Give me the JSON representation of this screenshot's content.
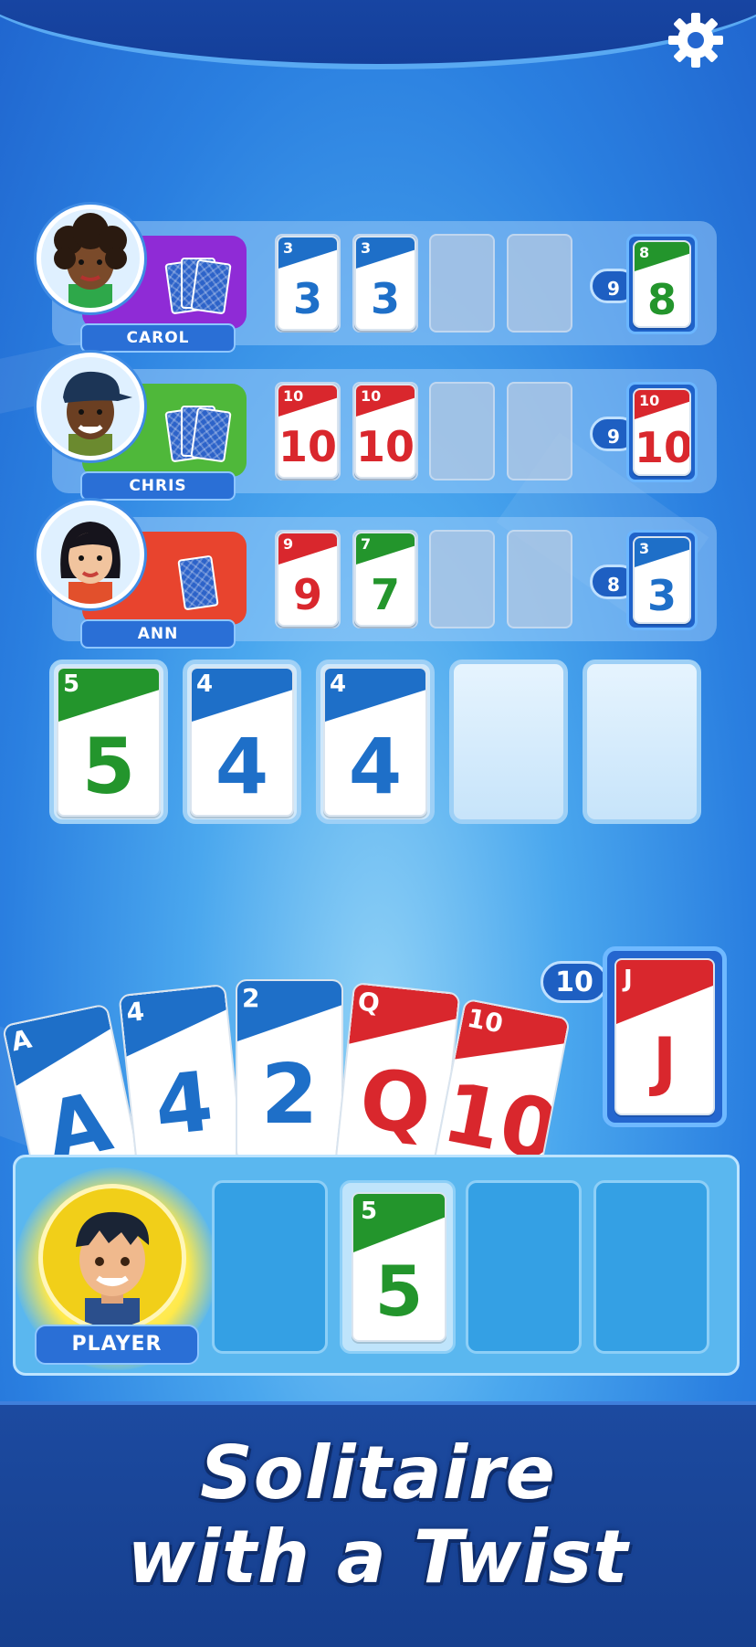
{
  "opponents": [
    {
      "name": "CAROL",
      "tag_color": "#8f2bd6",
      "cards": [
        {
          "v": "3",
          "c": "blue"
        },
        {
          "v": "3",
          "c": "blue"
        }
      ],
      "deck_count": "9",
      "deck_top": {
        "v": "8",
        "c": "green"
      }
    },
    {
      "name": "CHRIS",
      "tag_color": "#4fb83a",
      "cards": [
        {
          "v": "10",
          "c": "red"
        },
        {
          "v": "10",
          "c": "red"
        }
      ],
      "deck_count": "9",
      "deck_top": {
        "v": "10",
        "c": "red"
      }
    },
    {
      "name": "ANN",
      "tag_color": "#e8442e",
      "cards": [
        {
          "v": "9",
          "c": "red"
        },
        {
          "v": "7",
          "c": "green"
        }
      ],
      "deck_count": "8",
      "deck_top": {
        "v": "3",
        "c": "blue"
      }
    }
  ],
  "center_piles": [
    {
      "v": "5",
      "c": "green"
    },
    {
      "v": "4",
      "c": "blue"
    },
    {
      "v": "4",
      "c": "blue"
    }
  ],
  "hand": [
    {
      "v": "A",
      "c": "blue"
    },
    {
      "v": "4",
      "c": "blue"
    },
    {
      "v": "2",
      "c": "blue"
    },
    {
      "v": "Q",
      "c": "red"
    },
    {
      "v": "10",
      "c": "red"
    }
  ],
  "draw_pile": {
    "count": "10",
    "top": {
      "v": "J",
      "c": "red"
    }
  },
  "player": {
    "name": "PLAYER",
    "slot_card": {
      "v": "5",
      "c": "green"
    }
  },
  "tagline": {
    "line1": "Solitaire",
    "line2": "with a Twist"
  },
  "icons": {
    "settings": "gear-icon"
  }
}
